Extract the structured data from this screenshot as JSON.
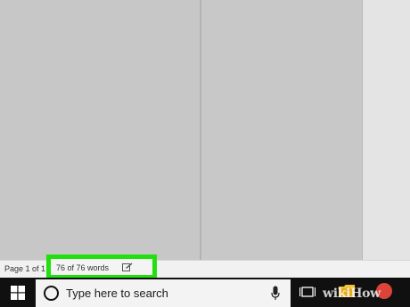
{
  "status_bar": {
    "page_count": "Page 1 of 1",
    "word_count": "76 of 76 words",
    "proofing_icon": "proofing-icon"
  },
  "taskbar": {
    "start_icon": "windows-logo-icon",
    "search_placeholder": "Type here to search",
    "cortana_icon": "cortana-icon",
    "mic_icon": "microphone-icon",
    "task_view_icon": "task-view-icon",
    "pinned_apps": [
      "file-explorer-icon",
      "chrome-icon"
    ]
  },
  "watermark": "wikiHow",
  "colors": {
    "highlight": "#22e00f",
    "taskbar": "#101010",
    "document_background": "#c6c6c6"
  }
}
